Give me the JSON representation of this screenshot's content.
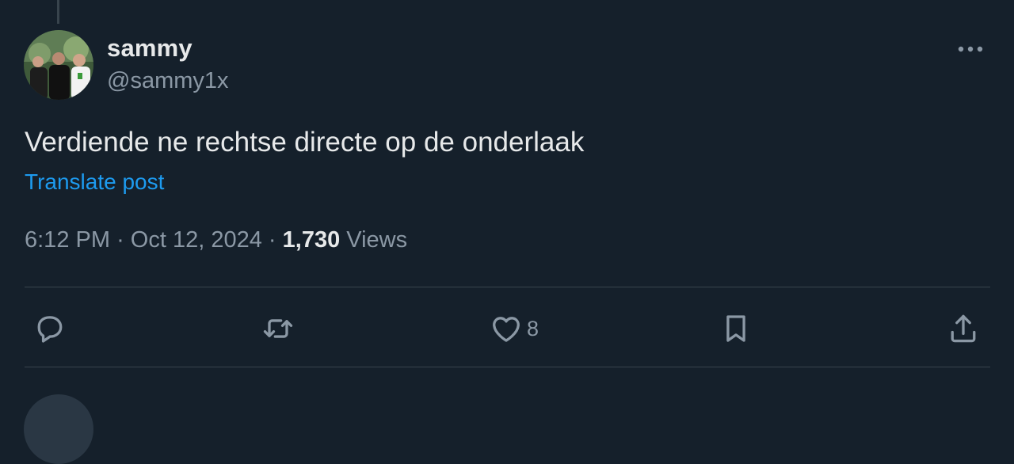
{
  "post": {
    "author_name": "sammy",
    "author_handle": "@sammy1x",
    "text": "Verdiende ne rechtse directe op de onderlaak",
    "translate_label": "Translate post",
    "time": "6:12 PM",
    "date": "Oct 12, 2024",
    "separator": "·",
    "view_count": "1,730",
    "views_label": "Views"
  },
  "actions": {
    "reply_count": "",
    "repost_count": "",
    "like_count": "8",
    "bookmark_count": ""
  },
  "icons": {
    "more": "more-icon",
    "reply": "reply-icon",
    "repost": "repost-icon",
    "like": "heart-icon",
    "bookmark": "bookmark-icon",
    "share": "share-icon"
  },
  "colors": {
    "background": "#15202b",
    "text": "#e7e9ea",
    "secondary": "#8b98a5",
    "link": "#1d9bf0",
    "divider": "#38444d"
  }
}
